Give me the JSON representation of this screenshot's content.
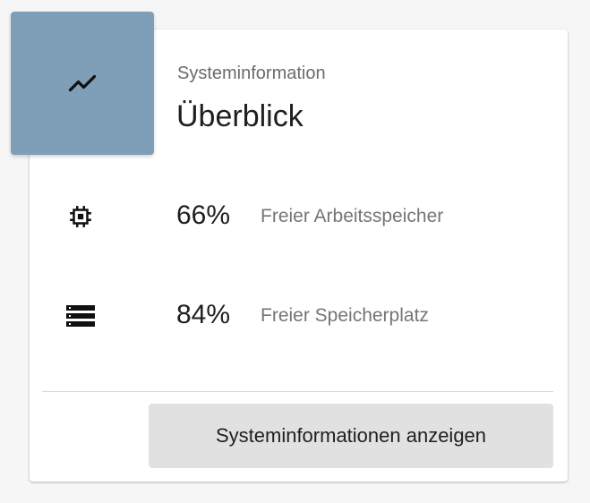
{
  "card": {
    "header_icon": "trending-up-icon",
    "header_color": "#7f9fb8",
    "subtitle": "Systeminformation",
    "title": "Überblick"
  },
  "stats": [
    {
      "icon": "memory-chip-icon",
      "value": "66%",
      "label": "Freier Arbeitsspeicher"
    },
    {
      "icon": "storage-icon",
      "value": "84%",
      "label": "Freier Speicherplatz"
    }
  ],
  "actions": {
    "show_button_label": "Systeminformationen anzeigen"
  }
}
